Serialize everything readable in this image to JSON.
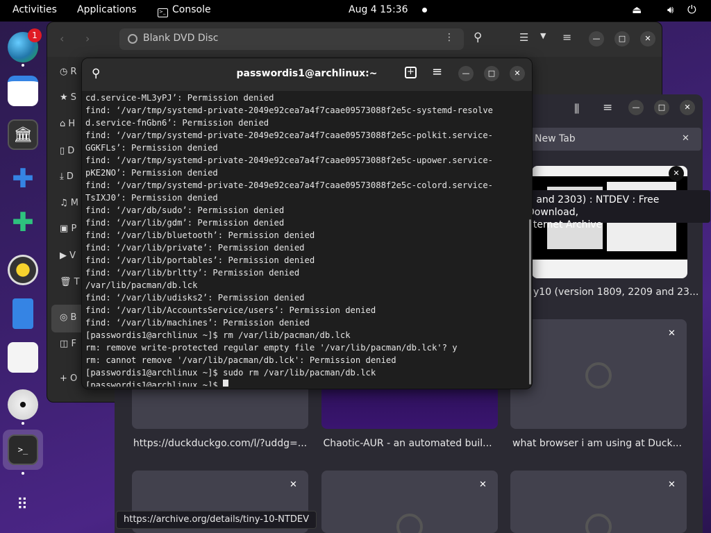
{
  "topbar": {
    "activities": "Activities",
    "applications": "Applications",
    "console": "Console",
    "clock": "Aug 4  15:36"
  },
  "dock": {
    "browser_badge": "1",
    "icons": [
      "firefox-icon",
      "calendar-icon",
      "archive-icon",
      "extensions-icon",
      "extension-manager-icon",
      "speaker-icon",
      "text-editor-icon",
      "software-icon",
      "disc-icon",
      "terminal-icon",
      "app-grid-icon"
    ]
  },
  "files": {
    "path": "Blank DVD Disc",
    "sidebar_letters": [
      "R",
      "S",
      "H",
      "D",
      "D",
      "M",
      "P",
      "V",
      "T",
      "B",
      "F",
      "O"
    ]
  },
  "browser": {
    "tab_label": "New Tab",
    "tooltip_line1": "9 and 2303) : NTDEV : Free Download,",
    "tooltip_line2": "nternet Archive",
    "tile_top_label": "y10 (version 1809, 2209 and 23...",
    "tiles_row2": [
      "https://duckduckgo.com/l/?uddg=...",
      "Chaotic-AUR - an automated buil...",
      "what browser i am using at Duck..."
    ],
    "status_url": "https://archive.org/details/tiny-10-NTDEV"
  },
  "terminal": {
    "title": "passwordis1@archlinux:~",
    "lines": [
      "cd.service-ML3yPJ’: Permission denied",
      "find: ‘/var/tmp/systemd-private-2049e92cea7a4f7caae09573088f2e5c-systemd-resolve",
      "d.service-fnGbn6’: Permission denied",
      "find: ‘/var/tmp/systemd-private-2049e92cea7a4f7caae09573088f2e5c-polkit.service-",
      "GGKFLs’: Permission denied",
      "find: ‘/var/tmp/systemd-private-2049e92cea7a4f7caae09573088f2e5c-upower.service-",
      "pKE2NO’: Permission denied",
      "find: ‘/var/tmp/systemd-private-2049e92cea7a4f7caae09573088f2e5c-colord.service-",
      "TsIXJ0’: Permission denied",
      "find: ‘/var/db/sudo’: Permission denied",
      "find: ‘/var/lib/gdm’: Permission denied",
      "find: ‘/var/lib/bluetooth’: Permission denied",
      "find: ‘/var/lib/private’: Permission denied",
      "find: ‘/var/lib/portables’: Permission denied",
      "find: ‘/var/lib/brltty’: Permission denied",
      "/var/lib/pacman/db.lck",
      "find: ‘/var/lib/udisks2’: Permission denied",
      "find: ‘/var/lib/AccountsService/users’: Permission denied",
      "find: ‘/var/lib/machines’: Permission denied",
      "[passwordis1@archlinux ~]$ rm /var/lib/pacman/db.lck",
      "rm: remove write-protected regular empty file '/var/lib/pacman/db.lck'? y",
      "rm: cannot remove '/var/lib/pacman/db.lck': Permission denied",
      "[passwordis1@archlinux ~]$ sudo rm /var/lib/pacman/db.lck",
      "[passwordis1@archlinux ~]$ "
    ]
  }
}
